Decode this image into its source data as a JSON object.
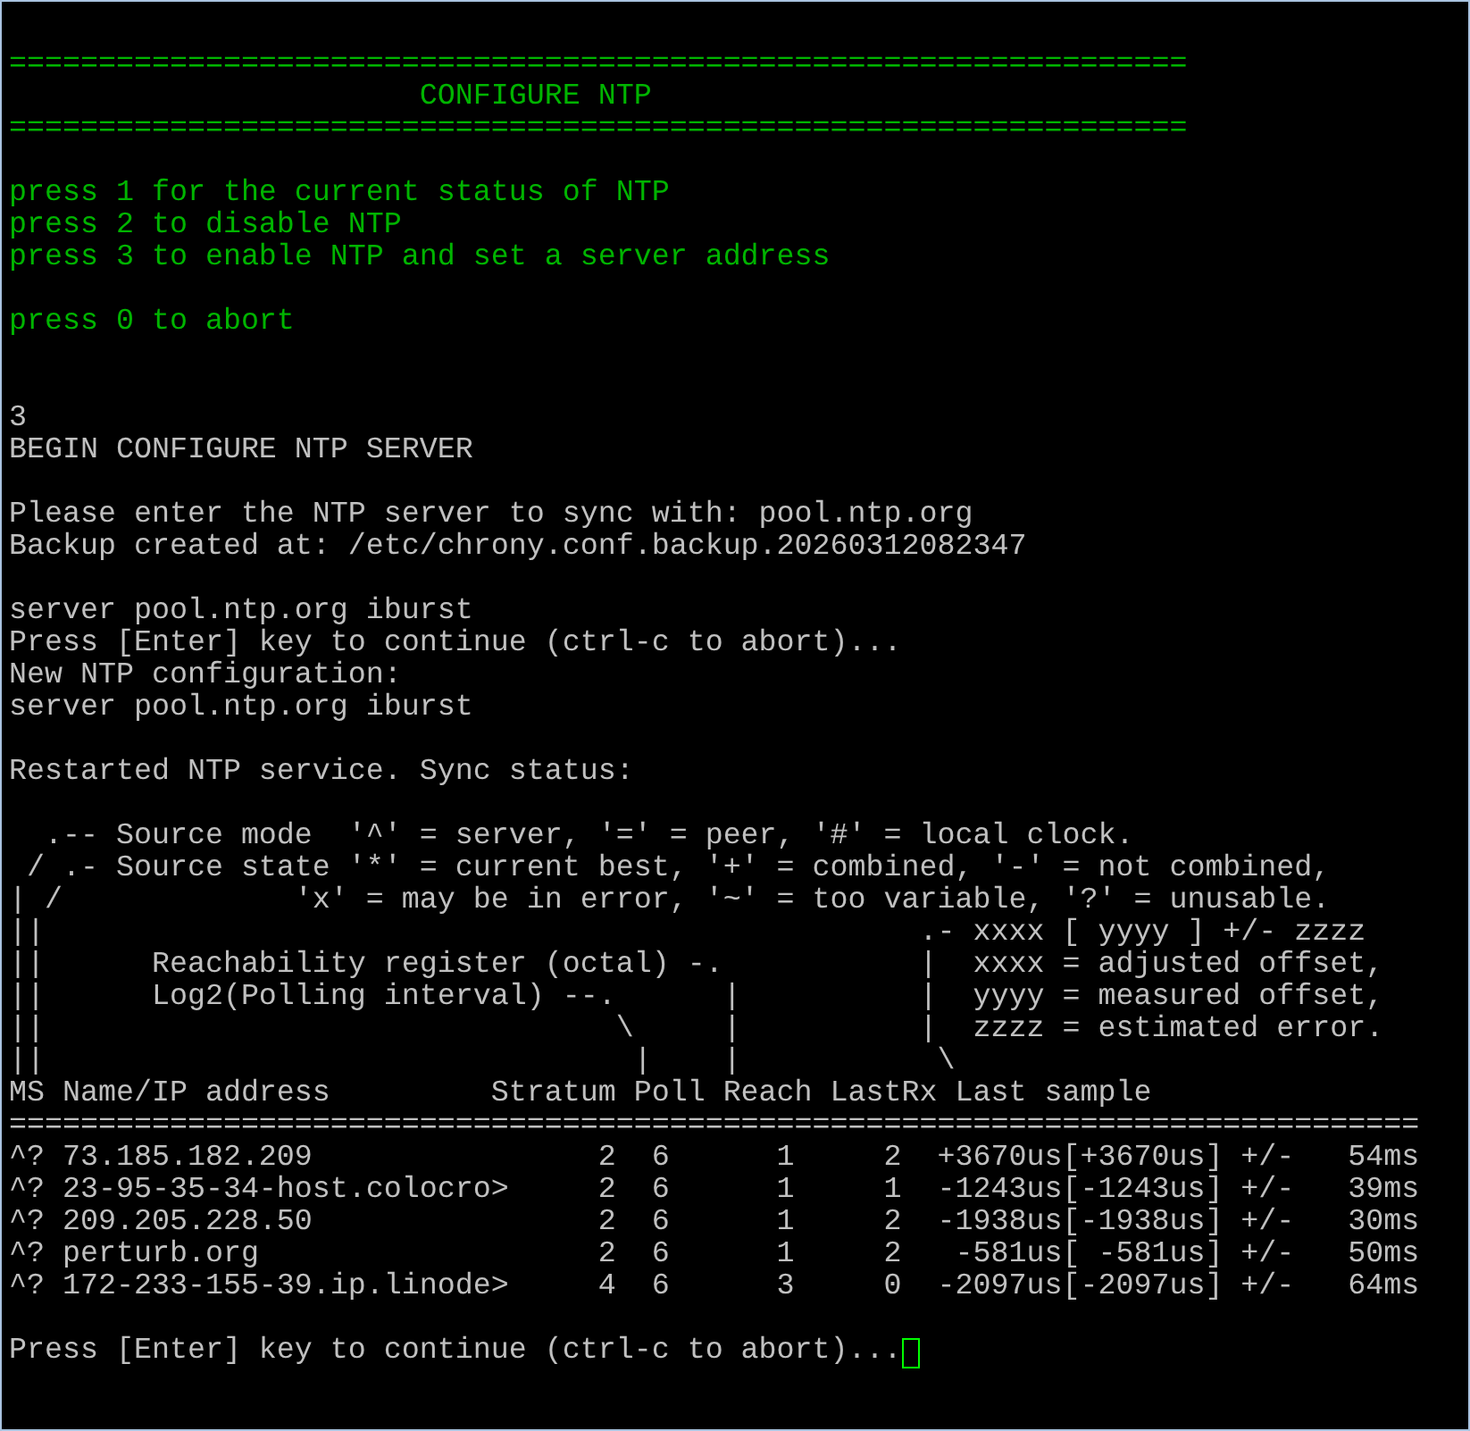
{
  "terminal": {
    "lines": [
      {
        "kind": "blank"
      },
      {
        "kind": "green",
        "text": "=================================================================="
      },
      {
        "kind": "green",
        "text": "                       CONFIGURE NTP"
      },
      {
        "kind": "green",
        "text": "=================================================================="
      },
      {
        "kind": "blank"
      },
      {
        "kind": "green",
        "text": "press 1 for the current status of NTP"
      },
      {
        "kind": "green",
        "text": "press 2 to disable NTP"
      },
      {
        "kind": "green",
        "text": "press 3 to enable NTP and set a server address"
      },
      {
        "kind": "blank"
      },
      {
        "kind": "green",
        "text": "press 0 to abort"
      },
      {
        "kind": "blank"
      },
      {
        "kind": "blank"
      },
      {
        "kind": "white",
        "text": "3"
      },
      {
        "kind": "white",
        "text": "BEGIN CONFIGURE NTP SERVER"
      },
      {
        "kind": "blank"
      },
      {
        "kind": "white",
        "text": "Please enter the NTP server to sync with: pool.ntp.org"
      },
      {
        "kind": "white",
        "text": "Backup created at: /etc/chrony.conf.backup.20260312082347"
      },
      {
        "kind": "blank"
      },
      {
        "kind": "white",
        "text": "server pool.ntp.org iburst"
      },
      {
        "kind": "white",
        "text": "Press [Enter] key to continue (ctrl-c to abort)..."
      },
      {
        "kind": "white",
        "text": "New NTP configuration:"
      },
      {
        "kind": "white",
        "text": "server pool.ntp.org iburst"
      },
      {
        "kind": "blank"
      },
      {
        "kind": "white",
        "text": "Restarted NTP service. Sync status:"
      },
      {
        "kind": "blank"
      },
      {
        "kind": "white",
        "text": "  .-- Source mode  '^' = server, '=' = peer, '#' = local clock."
      },
      {
        "kind": "white",
        "text": " / .- Source state '*' = current best, '+' = combined, '-' = not combined,"
      },
      {
        "kind": "white",
        "text": "| /             'x' = may be in error, '~' = too variable, '?' = unusable."
      },
      {
        "kind": "white",
        "text": "||                                                 .- xxxx [ yyyy ] +/- zzzz"
      },
      {
        "kind": "white",
        "text": "||      Reachability register (octal) -.           |  xxxx = adjusted offset,"
      },
      {
        "kind": "white",
        "text": "||      Log2(Polling interval) --.      |          |  yyyy = measured offset,"
      },
      {
        "kind": "white",
        "text": "||                                \\     |          |  zzzz = estimated error."
      },
      {
        "kind": "white",
        "text": "||                                 |    |           \\"
      },
      {
        "kind": "white",
        "text": "MS Name/IP address         Stratum Poll Reach LastRx Last sample"
      },
      {
        "kind": "white",
        "text": "==============================================================================="
      },
      {
        "kind": "white",
        "text": "^? 73.185.182.209                2  6      1     2  +3670us[+3670us] +/-   54ms"
      },
      {
        "kind": "white",
        "text": "^? 23-95-35-34-host.colocro>     2  6      1     1  -1243us[-1243us] +/-   39ms"
      },
      {
        "kind": "white",
        "text": "^? 209.205.228.50                2  6      1     2  -1938us[-1938us] +/-   30ms"
      },
      {
        "kind": "white",
        "text": "^? perturb.org                   2  6      1     2   -581us[ -581us] +/-   50ms"
      },
      {
        "kind": "white",
        "text": "^? 172-233-155-39.ip.linode>     4  6      3     0  -2097us[-2097us] +/-   64ms"
      },
      {
        "kind": "blank"
      },
      {
        "kind": "prompt",
        "text": "Press [Enter] key to continue (ctrl-c to abort)..."
      }
    ]
  }
}
